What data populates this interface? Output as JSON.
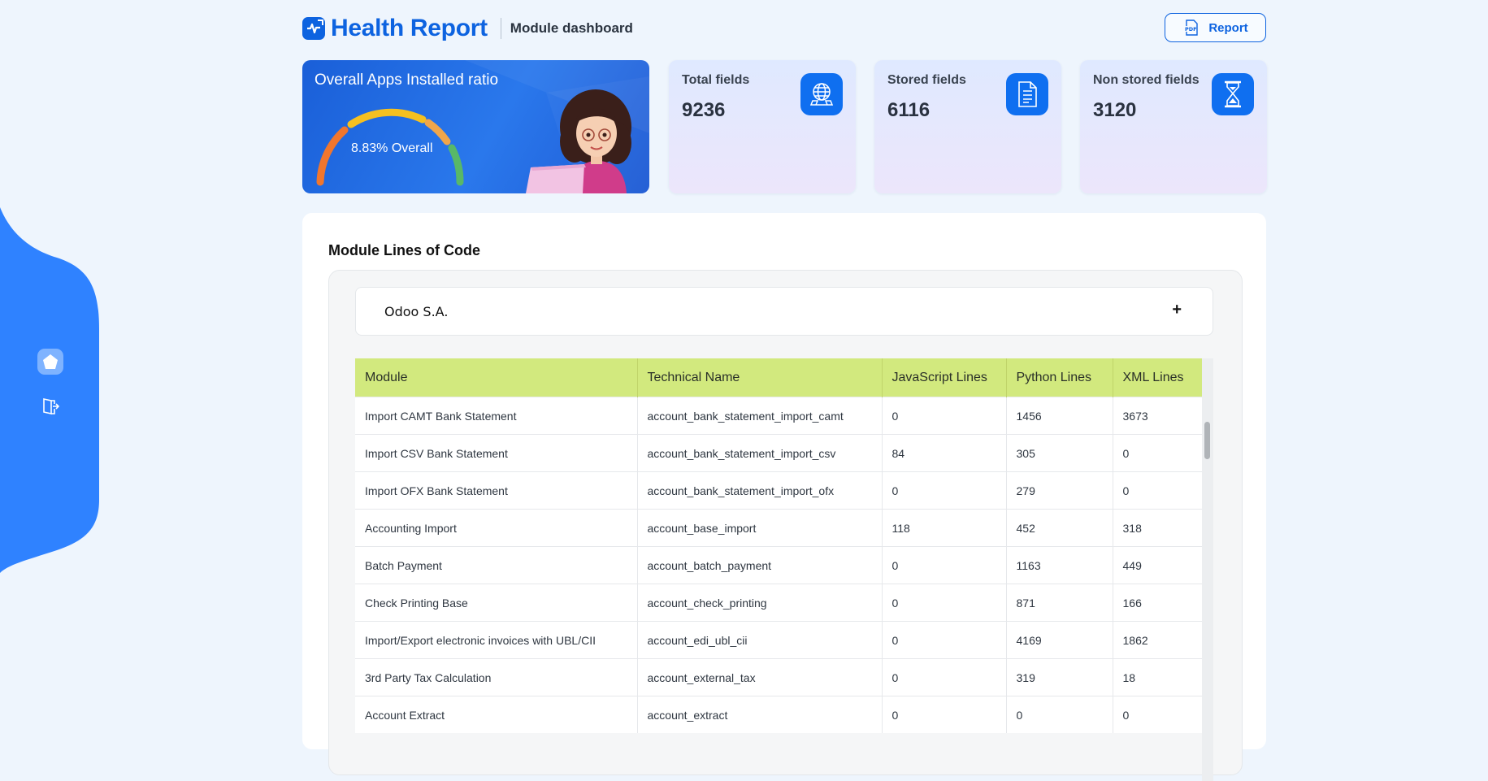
{
  "header": {
    "app_title": "Health Report",
    "subtitle": "Module dashboard",
    "report_button_label": "Report",
    "pdf_icon_text": "PDF"
  },
  "sidebar": {
    "items": [
      {
        "name": "home",
        "icon": "home-icon"
      },
      {
        "name": "logout",
        "icon": "logout-icon"
      }
    ],
    "accent": "#2f82ff"
  },
  "gauge": {
    "title": "Overall Apps Installed ratio",
    "label": "8.83% Overall",
    "colors": [
      "#f1762d",
      "#f5c020",
      "#f0a64a",
      "#58b868"
    ]
  },
  "stats": [
    {
      "label": "Total fields",
      "value": "9236",
      "icon": "globe-icon"
    },
    {
      "label": "Stored fields",
      "value": "6116",
      "icon": "document-icon"
    },
    {
      "label": "Non stored fields",
      "value": "3120",
      "icon": "hourglass-icon"
    }
  ],
  "main": {
    "title": "Module Lines of Code",
    "accordion_title": "Odoo S.A.",
    "accordion_toggle": "+",
    "columns": [
      "Module",
      "Technical Name",
      "JavaScript Lines",
      "Python Lines",
      "XML Lines"
    ],
    "rows": [
      [
        "Import CAMT Bank Statement",
        "account_bank_statement_import_camt",
        "0",
        "1456",
        "3673"
      ],
      [
        "Import CSV Bank Statement",
        "account_bank_statement_import_csv",
        "84",
        "305",
        "0"
      ],
      [
        "Import OFX Bank Statement",
        "account_bank_statement_import_ofx",
        "0",
        "279",
        "0"
      ],
      [
        "Accounting Import",
        "account_base_import",
        "118",
        "452",
        "318"
      ],
      [
        "Batch Payment",
        "account_batch_payment",
        "0",
        "1163",
        "449"
      ],
      [
        "Check Printing Base",
        "account_check_printing",
        "0",
        "871",
        "166"
      ],
      [
        "Import/Export electronic invoices with UBL/CII",
        "account_edi_ubl_cii",
        "0",
        "4169",
        "1862"
      ],
      [
        "3rd Party Tax Calculation",
        "account_external_tax",
        "0",
        "319",
        "18"
      ],
      [
        "Account Extract",
        "account_extract",
        "0",
        "0",
        "0"
      ]
    ],
    "header_color": "#d2e97e"
  }
}
